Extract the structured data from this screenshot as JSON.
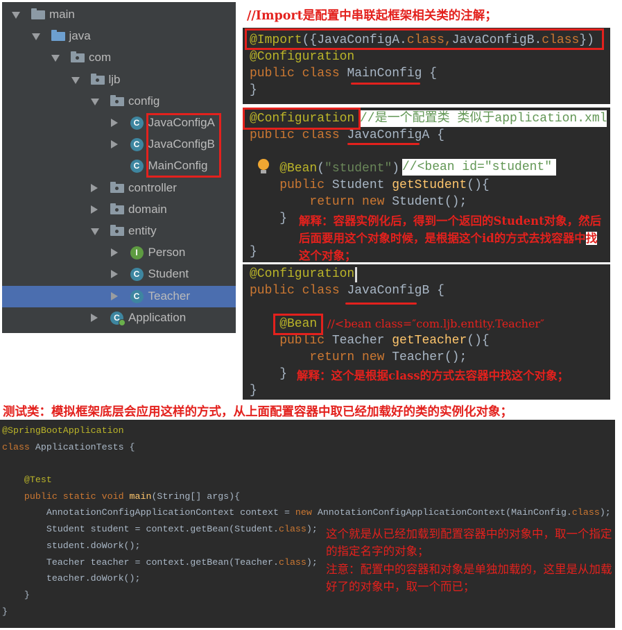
{
  "tree": {
    "items": [
      {
        "label": "main",
        "level": 0,
        "arrow": "open",
        "icon": "folder"
      },
      {
        "label": "java",
        "level": 1,
        "arrow": "open",
        "icon": "folder-blue"
      },
      {
        "label": "com",
        "level": 2,
        "arrow": "open",
        "icon": "package"
      },
      {
        "label": "ljb",
        "level": 3,
        "arrow": "open",
        "icon": "package"
      },
      {
        "label": "config",
        "level": 4,
        "arrow": "open",
        "icon": "package"
      },
      {
        "label": "JavaConfigA",
        "level": 5,
        "arrow": "closed",
        "icon": "class",
        "badge": "C"
      },
      {
        "label": "JavaConfigB",
        "level": 5,
        "arrow": "closed",
        "icon": "class",
        "badge": "C"
      },
      {
        "label": "MainConfig",
        "level": 5,
        "arrow": "none",
        "icon": "class",
        "badge": "C"
      },
      {
        "label": "controller",
        "level": 4,
        "arrow": "closed",
        "icon": "package"
      },
      {
        "label": "domain",
        "level": 4,
        "arrow": "closed",
        "icon": "package"
      },
      {
        "label": "entity",
        "level": 4,
        "arrow": "open",
        "icon": "package"
      },
      {
        "label": "Person",
        "level": 5,
        "arrow": "closed",
        "icon": "interface",
        "badge": "I"
      },
      {
        "label": "Student",
        "level": 5,
        "arrow": "closed",
        "icon": "class",
        "badge": "C"
      },
      {
        "label": "Teacher",
        "level": 5,
        "arrow": "closed",
        "icon": "class",
        "badge": "C",
        "selected": true
      },
      {
        "label": "Application",
        "level": 4,
        "arrow": "closed",
        "icon": "spring-application",
        "badge": "C"
      }
    ]
  },
  "captions": {
    "import_note": "//Import是配置中串联起框架相关类的注解；",
    "test_note": "测试类：模拟框架底层会应用这样的方式，从上面配置容器中取已经加载好的类的实例化对象；"
  },
  "code": {
    "panels": [
      {
        "lines": [
          [
            [
              "@Import",
              "ann"
            ],
            [
              "({JavaConfigA.",
              "txt"
            ],
            [
              "class,",
              "kw"
            ],
            [
              "JavaConfigB.",
              "txt"
            ],
            [
              "class",
              "kw"
            ],
            [
              "})",
              "txt"
            ]
          ],
          [
            [
              "@Configuration",
              "ann"
            ]
          ],
          [
            [
              "public class ",
              "kw"
            ],
            [
              "MainConfig",
              "txt"
            ],
            [
              " {",
              "txt"
            ]
          ],
          [
            [
              "}",
              "txt"
            ]
          ]
        ]
      },
      {
        "lines": [
          [
            [
              "@Configuration",
              "ann"
            ]
          ],
          [
            [
              "public class ",
              "kw"
            ],
            [
              "JavaConfigA",
              "txt"
            ],
            [
              " {",
              "txt"
            ]
          ],
          [],
          [
            [
              "    @Bean",
              "ann"
            ],
            [
              "(",
              "txt"
            ],
            [
              "\"student\"",
              "str"
            ],
            [
              ")",
              "txt"
            ]
          ],
          [
            [
              "    public ",
              "kw"
            ],
            [
              "Student ",
              "txt"
            ],
            [
              "getStudent",
              "meth"
            ],
            [
              "(){",
              "txt"
            ]
          ],
          [
            [
              "        return new ",
              "kw"
            ],
            [
              "Student();",
              "txt"
            ]
          ],
          [
            [
              "    }",
              "txt"
            ]
          ],
          [],
          [
            [
              "}",
              "txt"
            ]
          ]
        ]
      },
      {
        "lines": [
          [
            [
              "@Configuration",
              "ann"
            ]
          ],
          [
            [
              "public class ",
              "kw"
            ],
            [
              "JavaConfigB",
              "txt"
            ],
            [
              " {",
              "txt"
            ]
          ],
          [],
          [
            [
              "    @Bean",
              "ann"
            ]
          ],
          [
            [
              "    public ",
              "kw"
            ],
            [
              "Teacher ",
              "txt"
            ],
            [
              "getTeacher",
              "meth"
            ],
            [
              "(){",
              "txt"
            ]
          ],
          [
            [
              "        return new ",
              "kw"
            ],
            [
              "Teacher();",
              "txt"
            ]
          ],
          [
            [
              "    }",
              "txt"
            ]
          ],
          [
            [
              "}",
              "txt"
            ]
          ]
        ]
      },
      {
        "lines": [
          [
            [
              "@SpringBootApplication",
              "ann"
            ]
          ],
          [
            [
              "class ",
              "kw"
            ],
            [
              "ApplicationTests {",
              "txt"
            ]
          ],
          [],
          [
            [
              "    @Test",
              "ann"
            ]
          ],
          [
            [
              "    public static void ",
              "kw"
            ],
            [
              "main",
              "meth"
            ],
            [
              "(String[] args){",
              "txt"
            ]
          ],
          [
            [
              "        AnnotationConfigApplicationContext context = ",
              "txt"
            ],
            [
              "new ",
              "kw"
            ],
            [
              "AnnotationConfigApplicationContext(MainConfig.",
              "txt"
            ],
            [
              "class",
              "kw"
            ],
            [
              ");",
              "txt"
            ]
          ],
          [
            [
              "        Student student = context.getBean(Student.",
              "txt"
            ],
            [
              "class",
              "kw"
            ],
            [
              ");",
              "txt"
            ]
          ],
          [
            [
              "        student.doWork();",
              "txt"
            ]
          ],
          [
            [
              "        Teacher teacher = context.getBean(Teacher.",
              "txt"
            ],
            [
              "class",
              "kw"
            ],
            [
              ");",
              "txt"
            ]
          ],
          [
            [
              "        teacher.doWork();",
              "txt"
            ]
          ],
          [
            [
              "    }",
              "txt"
            ]
          ],
          [
            [
              "}",
              "txt"
            ]
          ]
        ]
      }
    ]
  },
  "comments": {
    "config_a_comment": "//是一个配置类 类似于application.xml",
    "bean_student_comment": "//<bean id=\"student\"",
    "bean_teacher_comment": "//<bean class=″com.ljb.entity.Teacher″"
  },
  "notes": {
    "student_before": "解释：容器实例化后，得到一个返回的Student对象，然后后面要用这个对象时候，是根据这个id的方式去找容器中",
    "student_highlight": "找",
    "student_after": "这个对象；",
    "teacher": "解释：这个是根据class的方式去容器中找这个对象；",
    "getbean": "这个就是从已经加载到配置容器中的对象中，取一个指定的指定名字的对象；",
    "attention": "注意：配置中的容器和对象是单独加载的，这里是从加载好了的对象中，取一个而已；"
  },
  "colors": {
    "annotation": "#bbb529",
    "keyword": "#cc7832",
    "text": "#a9b7c6",
    "string": "#6a8759",
    "method": "#ffc66d",
    "highlight_red": "#e3211d",
    "editor_bg": "#2b2b2b",
    "tree_bg": "#3c3f41",
    "selection": "#4b6eaf"
  }
}
